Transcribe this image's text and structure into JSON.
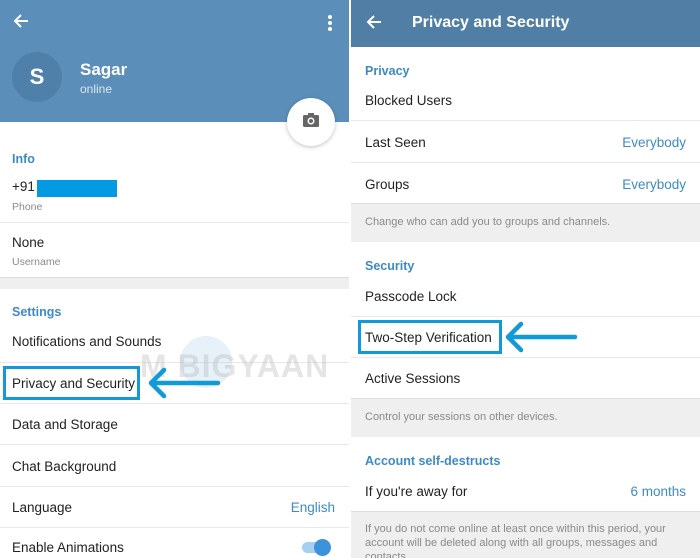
{
  "left": {
    "header": {
      "back_icon": "arrow-left-icon",
      "more_icon": "more-vert-icon",
      "avatar_initial": "S",
      "name": "Sagar",
      "status": "online",
      "camera_icon": "camera-icon"
    },
    "info": {
      "title": "Info",
      "phone_value": "+91",
      "phone_label": "Phone",
      "username_value": "None",
      "username_label": "Username"
    },
    "settings": {
      "title": "Settings",
      "items": [
        {
          "label": "Notifications and Sounds"
        },
        {
          "label": "Privacy and Security"
        },
        {
          "label": "Data and Storage"
        },
        {
          "label": "Chat Background"
        },
        {
          "label": "Language",
          "value": "English"
        },
        {
          "label": "Enable Animations",
          "toggle": true
        }
      ]
    },
    "watermark": "M  BIGYAAN"
  },
  "right": {
    "appbar": {
      "back_icon": "arrow-left-icon",
      "title": "Privacy and Security"
    },
    "privacy": {
      "title": "Privacy",
      "items": [
        {
          "label": "Blocked Users"
        },
        {
          "label": "Last Seen",
          "value": "Everybody"
        },
        {
          "label": "Groups",
          "value": "Everybody"
        }
      ],
      "description": "Change who can add you to groups and channels."
    },
    "security": {
      "title": "Security",
      "items": [
        {
          "label": "Passcode Lock"
        },
        {
          "label": "Two-Step Verification"
        },
        {
          "label": "Active Sessions"
        }
      ],
      "description": "Control your sessions on other devices."
    },
    "self_destruct": {
      "title": "Account self-destructs",
      "item": {
        "label": "If you're away for",
        "value": "6 months"
      },
      "description": "If you do not come online at least once within this period, your account will be deleted along with all groups, messages and contacts."
    }
  },
  "colors": {
    "header": "#5b8fba",
    "appbar": "#507ea4",
    "accent": "#3d8bc4",
    "annotation": "#109ad8"
  }
}
